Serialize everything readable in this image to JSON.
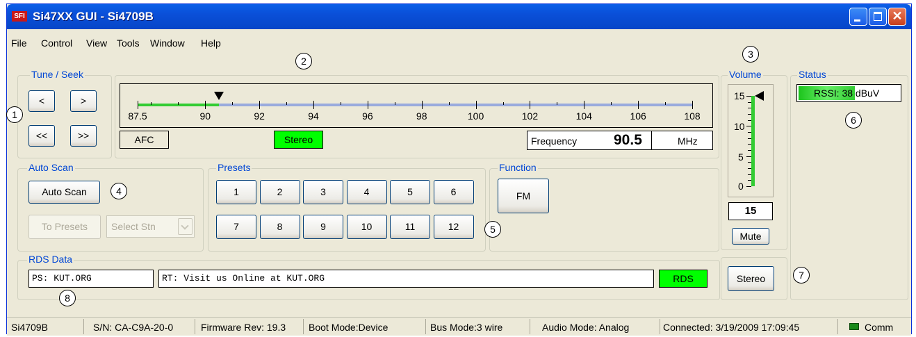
{
  "window": {
    "title": "Si47XX GUI - Si4709B",
    "app_icon": "SFI",
    "controls": [
      "minimize",
      "maximize",
      "close"
    ],
    "close_glyph": "✕"
  },
  "menu": [
    "File",
    "Control",
    "View",
    "Tools",
    "Window",
    "Help"
  ],
  "tune_seek": {
    "label": "Tune / Seek",
    "buttons": [
      "<",
      ">",
      "<<",
      ">>"
    ]
  },
  "tuner": {
    "scale_min": 87.5,
    "scale_max": 108,
    "tick_labels": [
      "87.5",
      "90",
      "92",
      "94",
      "96",
      "98",
      "100",
      "102",
      "104",
      "106",
      "108"
    ],
    "current_frequency_value": 90.5,
    "afc_label": "AFC",
    "stereo_indicator": "Stereo",
    "frequency_label": "Frequency",
    "frequency_value": "90.5",
    "frequency_unit": "MHz"
  },
  "volume": {
    "label": "Volume",
    "scale_labels": [
      "15",
      "10",
      "5",
      "0"
    ],
    "level": 15,
    "max": 15,
    "value": "15",
    "mute_label": "Mute"
  },
  "status_panel": {
    "label": "Status",
    "rssi_text": "RSSI: 38 dBuV",
    "rssi_fill_fraction": 0.55
  },
  "auto_scan": {
    "label": "Auto Scan",
    "auto_scan_button": "Auto Scan",
    "to_presets_button": "To Presets",
    "select_station": "Select Stn"
  },
  "presets": {
    "label": "Presets",
    "buttons": [
      "1",
      "2",
      "3",
      "4",
      "5",
      "6",
      "7",
      "8",
      "9",
      "10",
      "11",
      "12"
    ]
  },
  "function": {
    "label": "Function",
    "button": "FM"
  },
  "rds": {
    "label": "RDS Data",
    "ps": "PS: KUT.ORG",
    "rt": "RT: Visit us Online at KUT.ORG",
    "indicator": "RDS"
  },
  "stereo_button": "Stereo",
  "callouts": [
    "1",
    "2",
    "3",
    "4",
    "5",
    "6",
    "7",
    "8"
  ],
  "status_bar": {
    "chip": "Si4709B",
    "serial": "S/N: CA-C9A-20-0",
    "firmware": "Firmware Rev: 19.3",
    "boot_mode": "Boot Mode:Device",
    "bus_mode": "Bus Mode:3 wire",
    "audio_mode": "Audio Mode: Analog",
    "connected": "Connected: 3/19/2009 17:09:45",
    "comm": "Comm"
  },
  "colors": {
    "title_bar": "#0a4fd8",
    "group_label": "#0046d5",
    "indicator_green": "#00ff00",
    "comm_led": "#1a8a1a",
    "tuned_band": "#33cc33",
    "untuned_band": "#99aadd"
  }
}
